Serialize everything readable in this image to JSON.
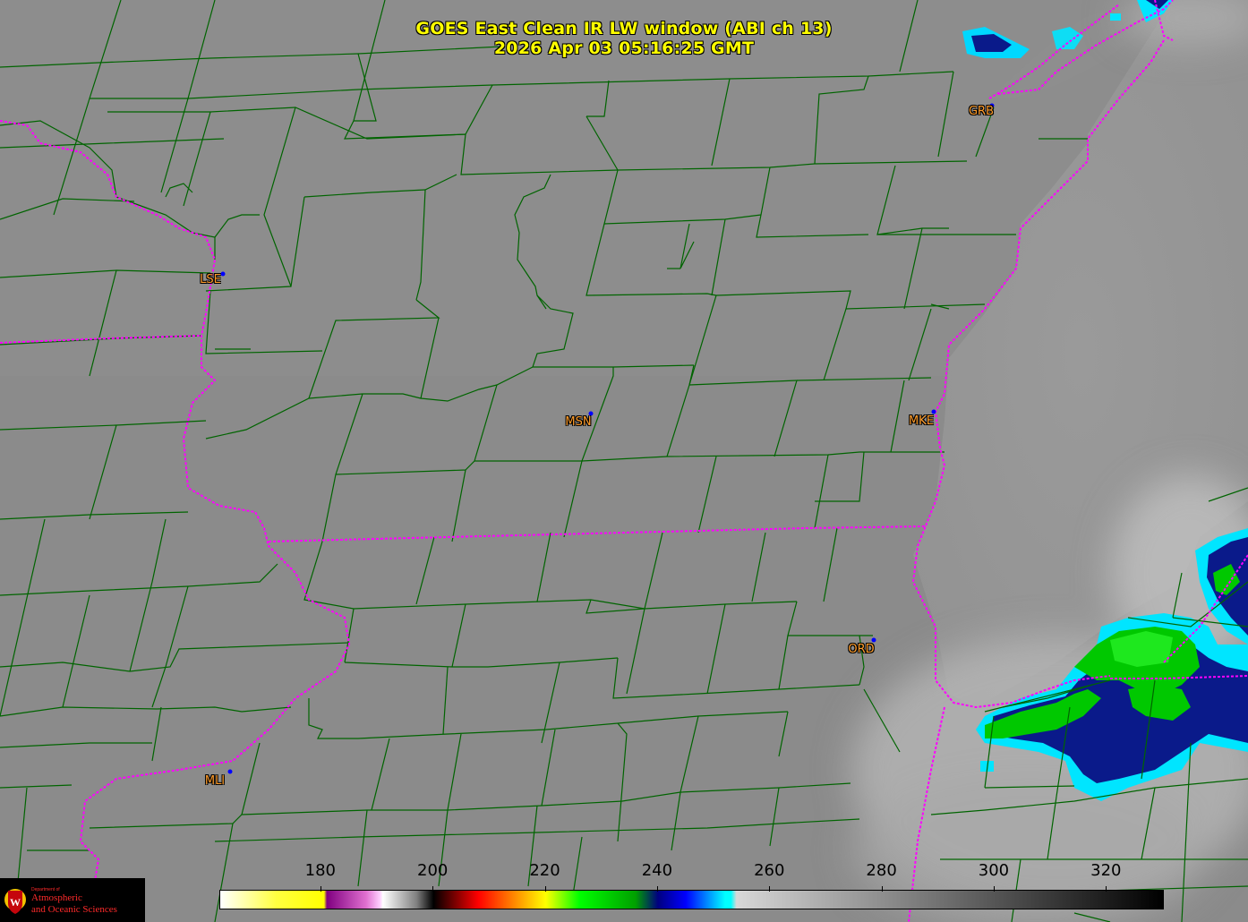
{
  "header": {
    "title": "GOES East Clean IR LW window (ABI ch 13)",
    "timestamp": "2026 Apr 03  05:16:25 GMT"
  },
  "stations": [
    {
      "code": "GRB"
    },
    {
      "code": "LSE"
    },
    {
      "code": "MSN"
    },
    {
      "code": "MKE"
    },
    {
      "code": "ORD"
    },
    {
      "code": "MLI"
    }
  ],
  "colorbar": {
    "min": 162,
    "max": 330,
    "ticks": [
      "180",
      "200",
      "220",
      "240",
      "260",
      "280",
      "300",
      "320"
    ]
  },
  "logo": {
    "dept": "Department of",
    "line1": "Atmospheric",
    "line2": "and Oceanic Sciences",
    "shield_letter": "W"
  },
  "colors": {
    "county_lines": "#006400",
    "state_lines": "#ff00ff",
    "title": "#ffff00",
    "station_label": "#ff9c2a",
    "station_dot": "#0000ff",
    "cloud_green": "#00c800",
    "cloud_blue": "#001a80",
    "cloud_cyan": "#00e5ff"
  }
}
